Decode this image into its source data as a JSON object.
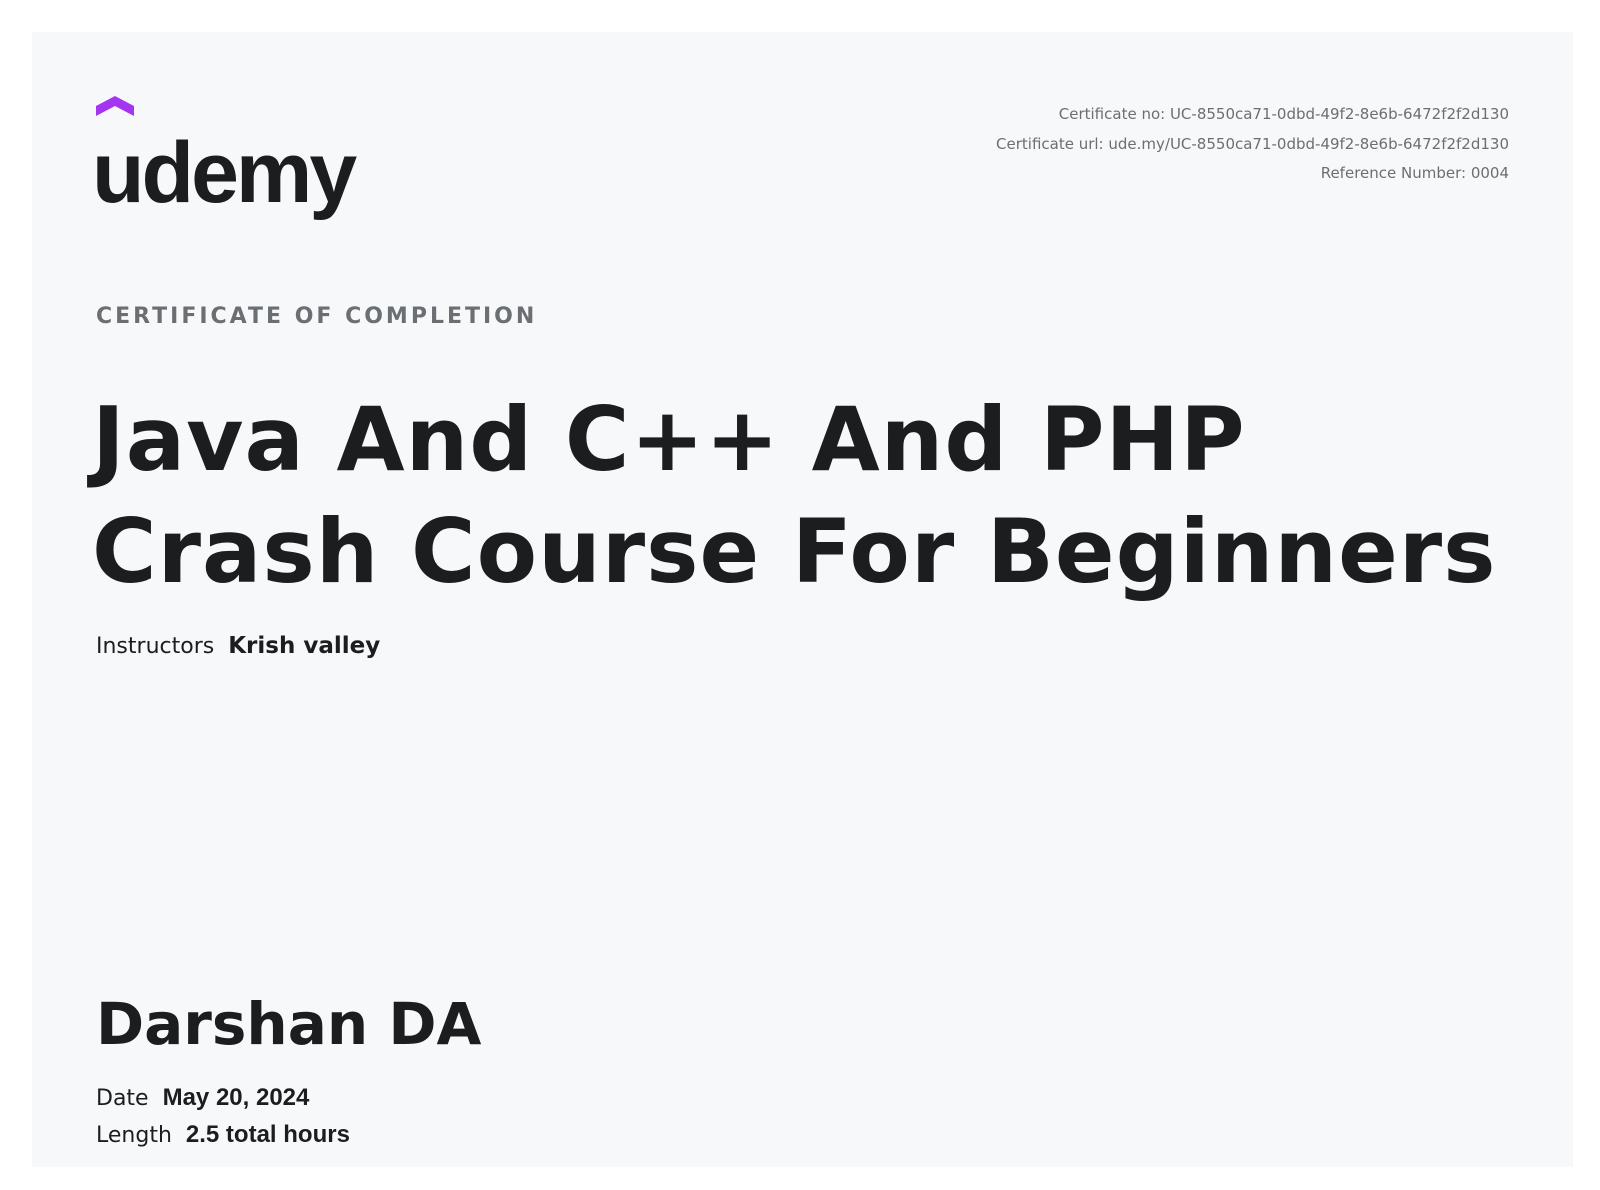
{
  "brand": {
    "name": "udemy",
    "accent_color": "#a435f0",
    "text_color": "#1c1d1f"
  },
  "meta": {
    "certificate_no": "Certificate no: UC-8550ca71-0dbd-49f2-8e6b-6472f2f2d130",
    "certificate_url": "Certificate url: ude.my/UC-8550ca71-0dbd-49f2-8e6b-6472f2f2d130",
    "reference_number": "Reference Number: 0004"
  },
  "certificate": {
    "label": "CERTIFICATE OF COMPLETION",
    "course_title_line1": "Java And C++ And PHP",
    "course_title_line2": "Crash Course For Beginners",
    "instructors_label": "Instructors",
    "instructors_value": "Krish valley",
    "student_name": "Darshan DA",
    "date_label": "Date",
    "date_value": "May 20, 2024",
    "length_label": "Length",
    "length_value": "2.5 total hours"
  }
}
